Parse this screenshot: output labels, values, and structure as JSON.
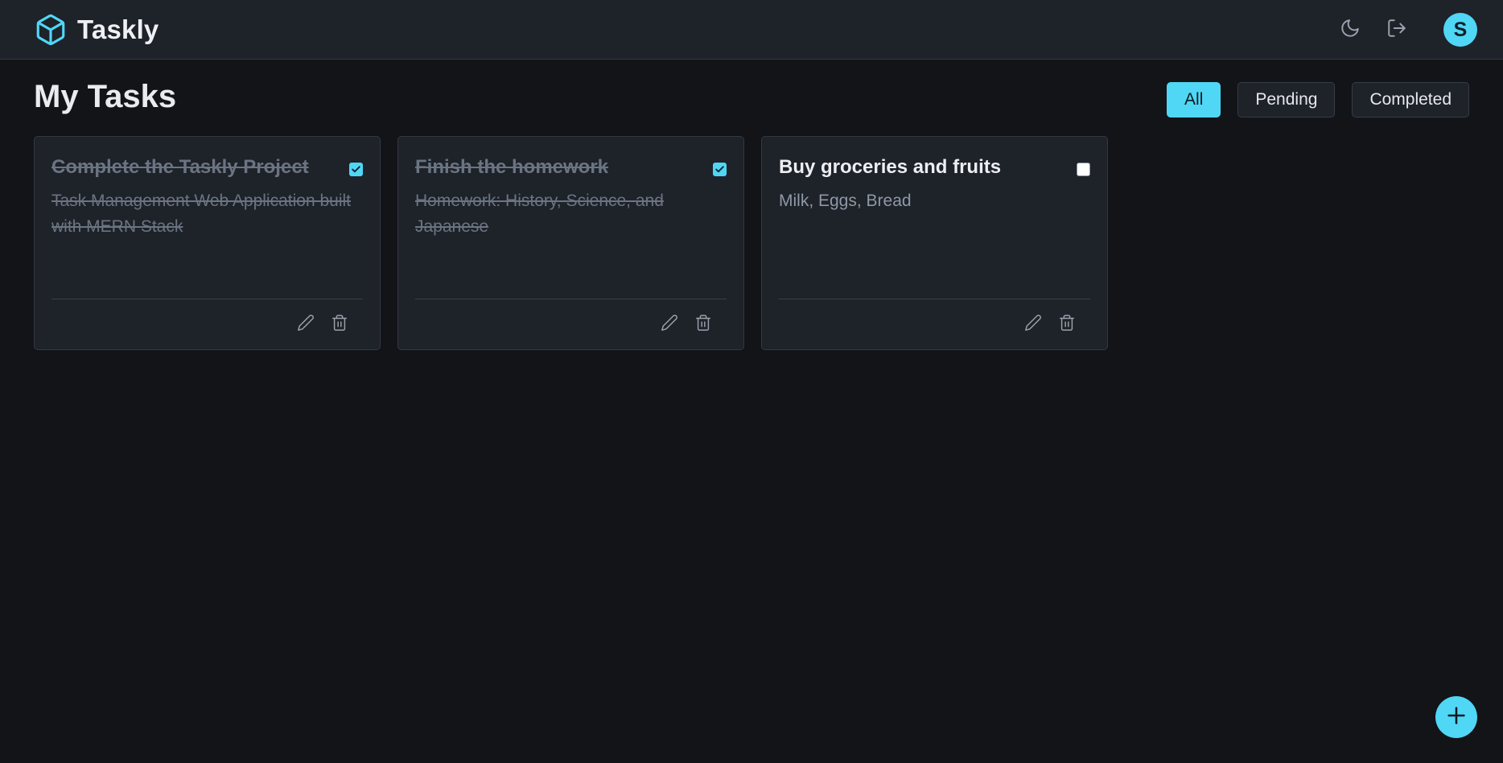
{
  "app": {
    "name": "Taskly",
    "logo_icon": "cube-icon",
    "accent_color": "#4fd7f5",
    "background_color": "#121418",
    "surface_color": "#1e2229"
  },
  "header": {
    "theme_toggle_icon": "moon-icon",
    "logout_icon": "logout-icon",
    "avatar_initial": "S"
  },
  "page": {
    "title": "My Tasks"
  },
  "filters": {
    "all": "All",
    "pending": "Pending",
    "completed": "Completed",
    "selected": "All"
  },
  "tasks": [
    {
      "title": "Complete the Taskly Project",
      "description": "Task Management Web Application built with MERN Stack",
      "completed": true
    },
    {
      "title": "Finish the homework",
      "description": "Homework: History, Science, and Japanese",
      "completed": true
    },
    {
      "title": "Buy groceries and fruits",
      "description": "Milk, Eggs, Bread",
      "completed": false
    }
  ],
  "card_actions": {
    "edit_icon": "pencil-icon",
    "delete_icon": "trash-icon"
  },
  "fab": {
    "icon": "plus-icon"
  }
}
